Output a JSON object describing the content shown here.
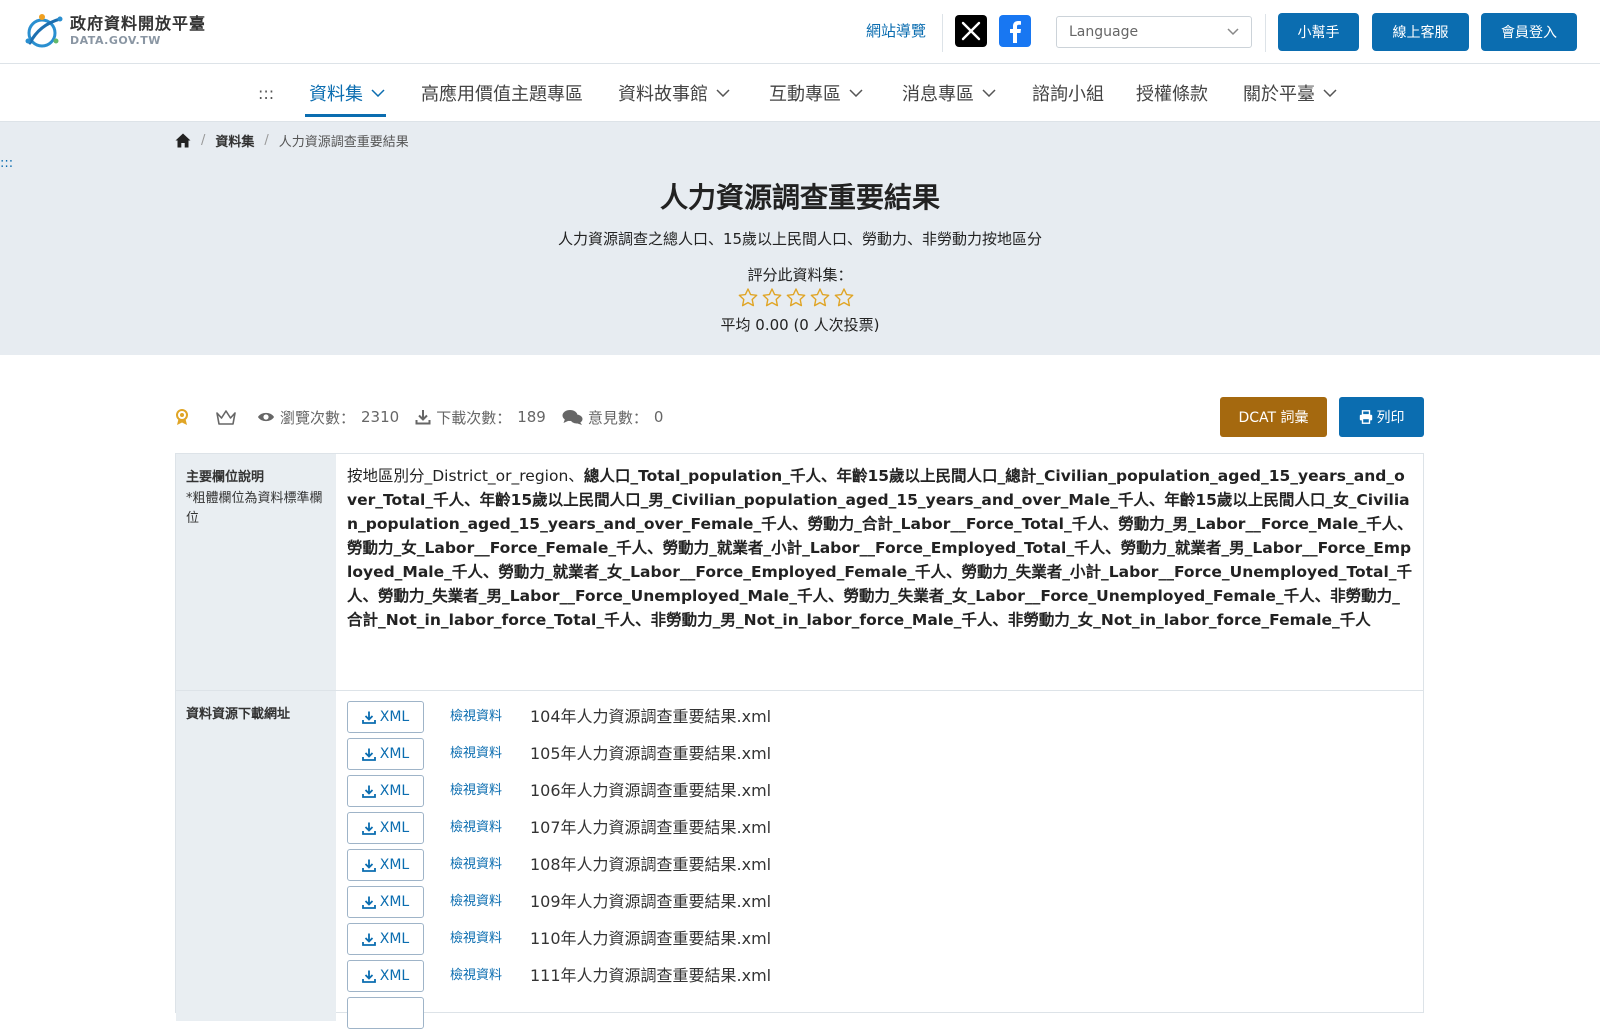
{
  "header": {
    "logo_zh": "政府資料開放平臺",
    "logo_en": "DATA.GOV.TW",
    "sitemap": "網站導覽",
    "language_placeholder": "Language",
    "buttons": [
      "小幫手",
      "線上客服",
      "會員登入"
    ]
  },
  "nav": {
    "skip": ":::",
    "items": [
      "資料集",
      "高應用價值主題專區",
      "資料故事館",
      "互動專區",
      "消息專區",
      "諮詢小組",
      "授權條款",
      "關於平臺"
    ]
  },
  "breadcrumb": {
    "items": [
      "資料集",
      "人力資源調查重要結果"
    ]
  },
  "hero": {
    "skip_anchor": ":::",
    "title": "人力資源調查重要結果",
    "subtitle": "人力資源調查之總人口、15歲以上民間人口、勞動力、非勞動力按地區分",
    "rate_label": "評分此資料集：",
    "rating": 0,
    "avg_text": "平均 0.00 (0 人次投票)"
  },
  "stats": {
    "views_label": "瀏覽次數：",
    "views": "2310",
    "downloads_label": "下載次數：",
    "downloads": "189",
    "comments_label": "意見數：",
    "comments": "0"
  },
  "actions": {
    "dcat": "DCAT 詞彙",
    "print": "列印"
  },
  "fields": {
    "head_title": "主要欄位說明",
    "head_note": "*粗體欄位為資料標準欄位",
    "plain_prefix": "按地區別分_District_or_region、",
    "bold_text": "總人口_Total_population_千人、年齡15歲以上民間人口_總計_Civilian_population_aged_15_years_and_over_Total_千人、年齡15歲以上民間人口_男_Civilian_population_aged_15_years_and_over_Male_千人、年齡15歲以上民間人口_女_Civilian_population_aged_15_years_and_over_Female_千人、勞動力_合計_Labor__Force_Total_千人、勞動力_男_Labor__Force_Male_千人、勞動力_女_Labor__Force_Female_千人、勞動力_就業者_小計_Labor__Force_Employed_Total_千人、勞動力_就業者_男_Labor__Force_Employed_Male_千人、勞動力_就業者_女_Labor__Force_Employed_Female_千人、勞動力_失業者_小計_Labor__Force_Unemployed_Total_千人、勞動力_失業者_男_Labor__Force_Unemployed_Male_千人、勞動力_失業者_女_Labor__Force_Unemployed_Female_千人、非勞動力_合計_Not_in_labor_force_Total_千人、非勞動力_男_Not_in_labor_force_Male_千人、非勞動力_女_Not_in_labor_force_Female_千人"
  },
  "resources": {
    "head_title": "資料資源下載網址",
    "format_label": "XML",
    "view_label": "檢視資料",
    "items": [
      "104年人力資源調查重要結果.xml",
      "105年人力資源調查重要結果.xml",
      "106年人力資源調查重要結果.xml",
      "107年人力資源調查重要結果.xml",
      "108年人力資源調查重要結果.xml",
      "109年人力資源調查重要結果.xml",
      "110年人力資源調查重要結果.xml",
      "111年人力資源調查重要結果.xml"
    ]
  },
  "colors": {
    "primary": "#0b6db0",
    "dcat": "#a5690f",
    "hero_bg": "#e7ecf1",
    "star": "#e0a526"
  }
}
